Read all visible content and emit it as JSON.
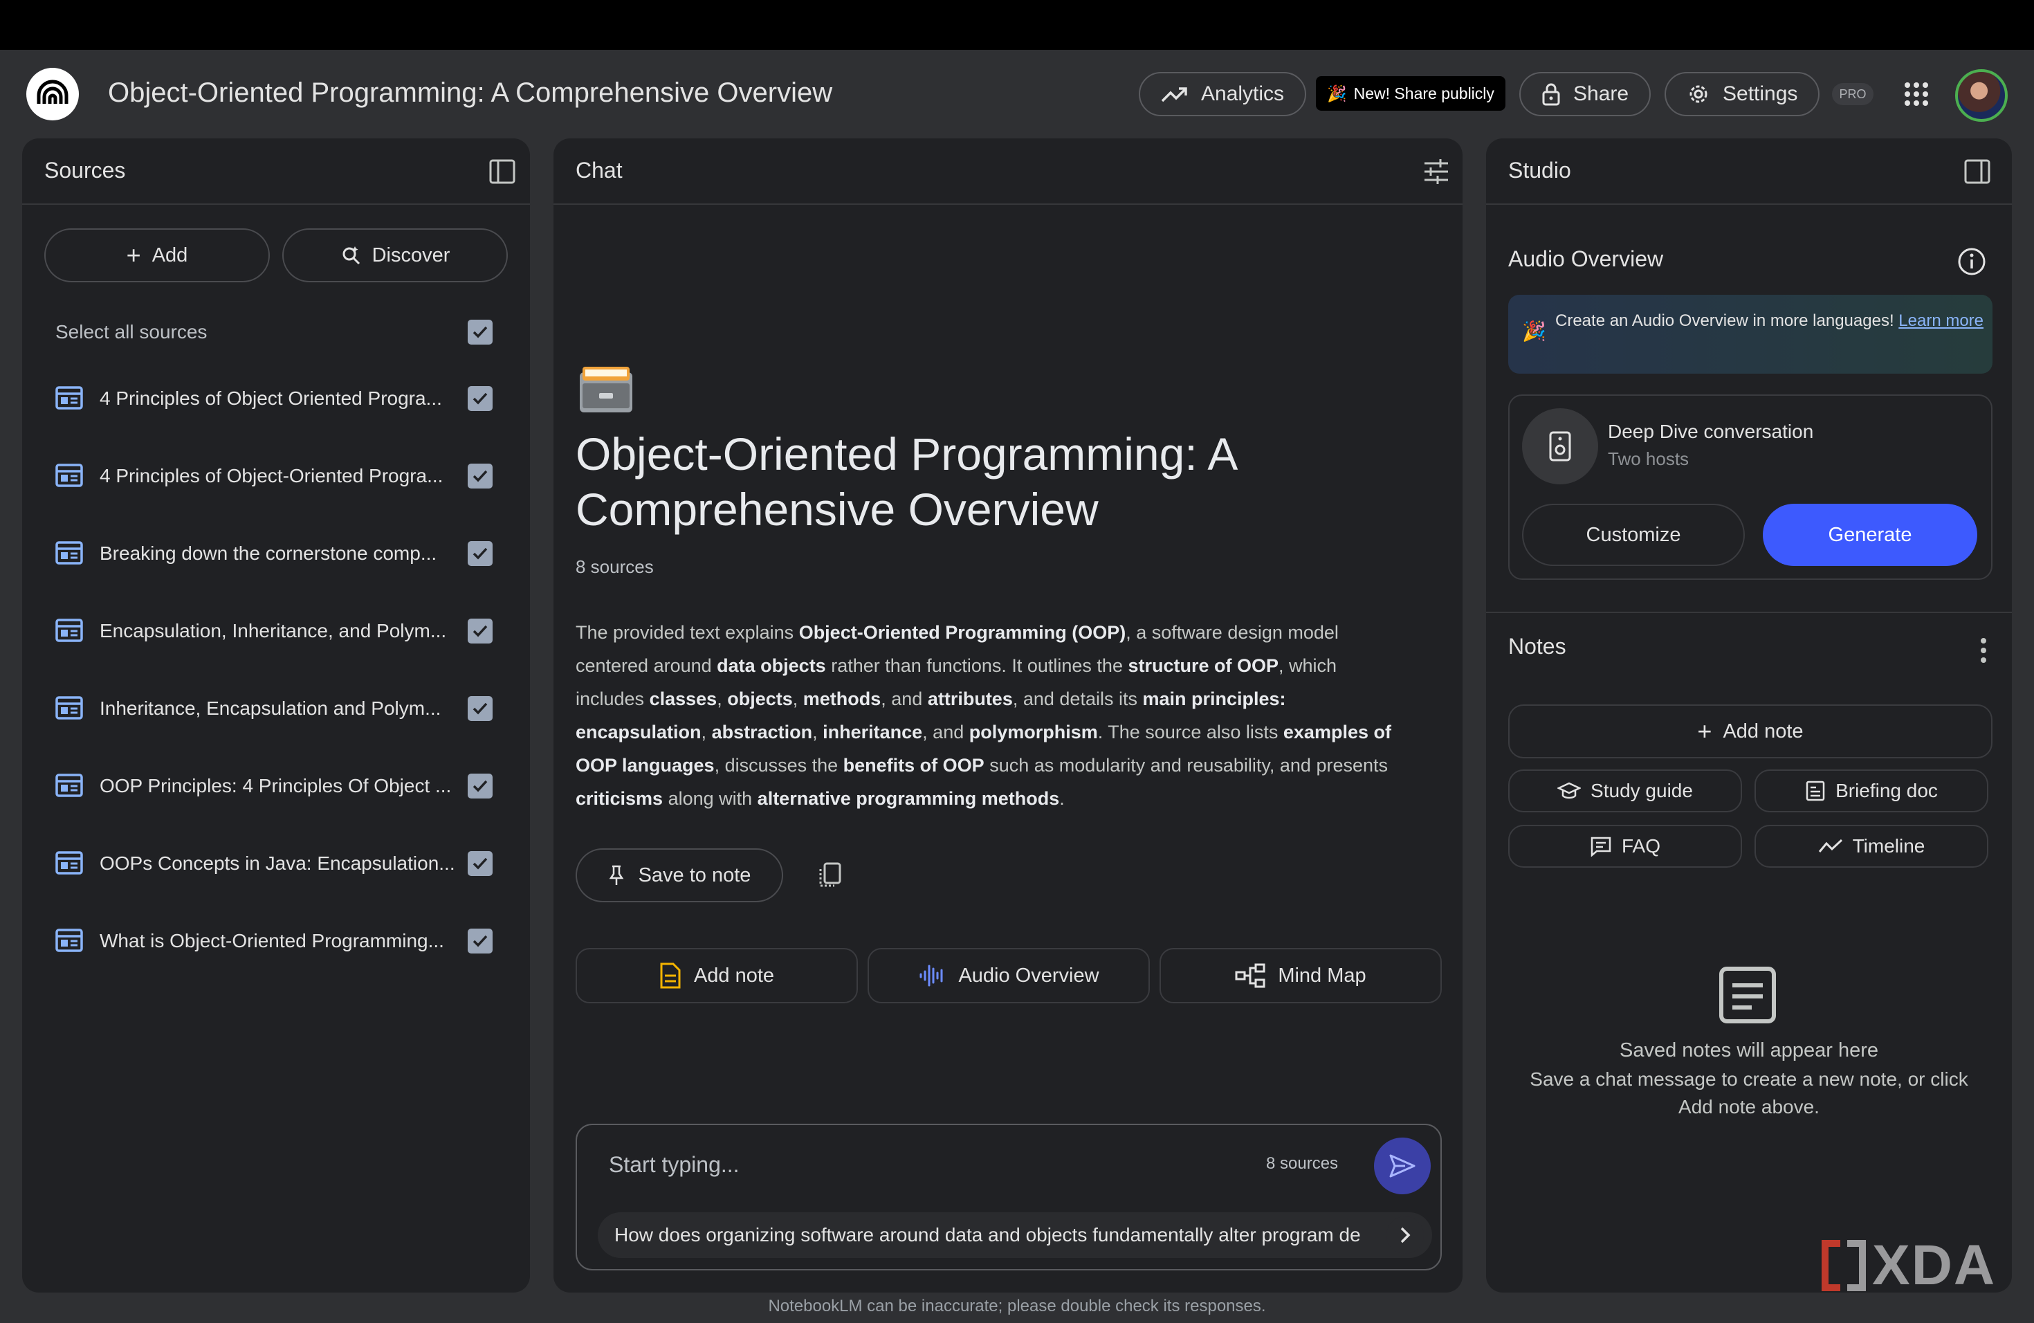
{
  "header": {
    "title": "Object-Oriented Programming: A Comprehensive Overview",
    "analytics_label": "Analytics",
    "new_badge_label": "New! Share publicly",
    "share_label": "Share",
    "settings_label": "Settings",
    "pro_label": "PRO"
  },
  "sources": {
    "title": "Sources",
    "add_label": "Add",
    "discover_label": "Discover",
    "select_all_label": "Select all sources",
    "items": [
      {
        "label": "4 Principles of Object Oriented Progra..."
      },
      {
        "label": "4 Principles of Object-Oriented Progra..."
      },
      {
        "label": "Breaking down the cornerstone comp..."
      },
      {
        "label": "Encapsulation, Inheritance, and Polym..."
      },
      {
        "label": "Inheritance, Encapsulation and Polym..."
      },
      {
        "label": "OOP Principles: 4 Principles Of Object ..."
      },
      {
        "label": "OOPs Concepts in Java: Encapsulation..."
      },
      {
        "label": "What is Object-Oriented Programming..."
      }
    ]
  },
  "chat": {
    "title": "Chat",
    "notebook_title": "Object-Oriented Programming: A Comprehensive Overview",
    "source_count": "8 sources",
    "summary": {
      "p1": "The provided text explains ",
      "b1": "Object-Oriented Programming (OOP)",
      "p2": ", a software design model centered around ",
      "b2": "data objects",
      "p3": " rather than functions. It outlines the ",
      "b3": "structure of OOP",
      "p4": ", which includes ",
      "b4": "classes",
      "p5": ", ",
      "b5": "objects",
      "p6": ", ",
      "b6": "methods",
      "p7": ", and ",
      "b7": "attributes",
      "p8": ", and details its ",
      "b8": "main principles: encapsulation",
      "p9": ", ",
      "b9": "abstraction",
      "p10": ", ",
      "b10": "inheritance",
      "p11": ", and ",
      "b11": "polymorphism",
      "p12": ". The source also lists ",
      "b12": "examples of OOP languages",
      "p13": ", discusses the ",
      "b13": "benefits of OOP",
      "p14": " such as modularity and reusability, and presents ",
      "b14": "criticisms",
      "p15": " along with ",
      "b15": "alternative programming methods",
      "p16": "."
    },
    "save_to_note_label": "Save to note",
    "actions": {
      "add_note": "Add note",
      "audio_overview": "Audio Overview",
      "mind_map": "Mind Map"
    },
    "input_placeholder": "Start typing...",
    "input_source_count": "8 sources",
    "suggestion": "How does organizing software around data and objects fundamentally alter program de"
  },
  "studio": {
    "title": "Studio",
    "audio_overview_title": "Audio Overview",
    "banner_text": "Create an Audio Overview in more languages! ",
    "banner_link": "Learn more",
    "deep_dive_title": "Deep Dive conversation",
    "deep_dive_sub": "Two hosts",
    "customize_label": "Customize",
    "generate_label": "Generate",
    "notes_title": "Notes",
    "add_note_label": "Add note",
    "study_guide_label": "Study guide",
    "briefing_doc_label": "Briefing doc",
    "faq_label": "FAQ",
    "timeline_label": "Timeline",
    "empty_title": "Saved notes will appear here",
    "empty_desc": "Save a chat message to create a new note, or click Add note above."
  },
  "footer": {
    "disclaimer": "NotebookLM can be inaccurate; please double check its responses."
  },
  "watermark": {
    "text": "XDA"
  },
  "colors": {
    "accent": "#3d5afe",
    "panel": "#202124",
    "background": "#2f3033",
    "source_icon": "#8ab4f8"
  }
}
